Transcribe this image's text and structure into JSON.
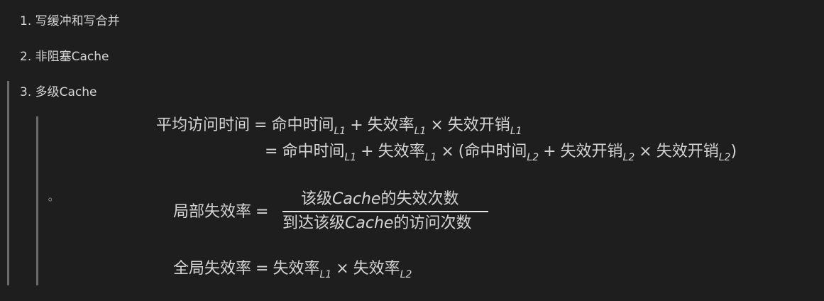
{
  "list": [
    {
      "marker": "1.",
      "text": "写缓冲和写合并"
    },
    {
      "marker": "2.",
      "text": "非阻塞Cache"
    },
    {
      "marker": "3.",
      "text": "多级Cache"
    }
  ],
  "sub_bullet": "◦",
  "eq1": {
    "lhs": "平均访问时间",
    "eq": "=",
    "hit": "命中时间",
    "plus": "+",
    "miss_rate": "失效率",
    "times": "×",
    "miss_cost": "失效开销",
    "sub_l1": "L1",
    "sub_l2": "L2",
    "open": "(",
    "close": ")"
  },
  "eq2": {
    "lhs": "局部失效率",
    "eq": "=",
    "num_a": "该级",
    "num_cache": "Cache",
    "num_b": "的失效次数",
    "den_a": "到达该级",
    "den_cache": "Cache",
    "den_b": "的访问次数"
  },
  "eq3": {
    "lhs": "全局失效率",
    "eq": "=",
    "miss_rate": "失效率",
    "times": "×",
    "sub_l1": "L1",
    "sub_l2": "L2"
  }
}
